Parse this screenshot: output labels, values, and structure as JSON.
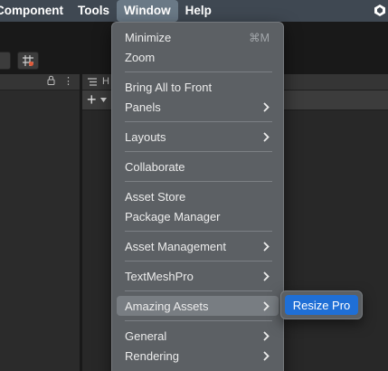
{
  "menubar": {
    "items": [
      "Component",
      "Tools",
      "Window",
      "Help"
    ],
    "active_index": 2
  },
  "window_menu": {
    "items": [
      {
        "label": "Minimize",
        "shortcut": "⌘M",
        "submenu": false
      },
      {
        "label": "Zoom",
        "shortcut": "",
        "submenu": false
      },
      {
        "label": "Bring All to Front",
        "shortcut": "",
        "submenu": false
      },
      {
        "label": "Panels",
        "shortcut": "",
        "submenu": true
      },
      {
        "label": "Layouts",
        "shortcut": "",
        "submenu": true
      },
      {
        "label": "Collaborate",
        "shortcut": "",
        "submenu": false
      },
      {
        "label": "Asset Store",
        "shortcut": "",
        "submenu": false
      },
      {
        "label": "Package Manager",
        "shortcut": "",
        "submenu": false
      },
      {
        "label": "Asset Management",
        "shortcut": "",
        "submenu": true
      },
      {
        "label": "TextMeshPro",
        "shortcut": "",
        "submenu": true
      },
      {
        "label": "Amazing Assets",
        "shortcut": "",
        "submenu": true,
        "highlighted": true
      },
      {
        "label": "General",
        "shortcut": "",
        "submenu": true
      },
      {
        "label": "Rendering",
        "shortcut": "",
        "submenu": true
      }
    ]
  },
  "submenu": {
    "items": [
      "Resize Pro"
    ]
  },
  "editor": {
    "hierarchy_tab_label": "H",
    "add_glyph": "+",
    "lock_glyph": "🔒",
    "more_glyph": "⋮"
  },
  "colors": {
    "menubar_bg": "#3f4852",
    "menu_bg": "#5c6064",
    "highlight_bg": "#787d82",
    "selection_blue": "#1f6fd6"
  }
}
